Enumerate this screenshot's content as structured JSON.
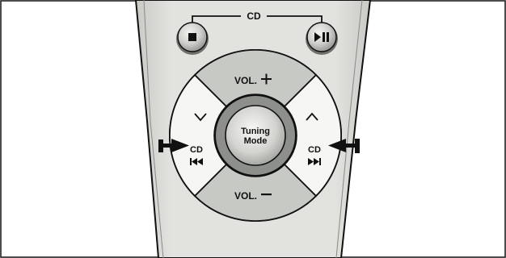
{
  "cd_group_label": "CD",
  "buttons": {
    "stop": {
      "icon": "stop-icon"
    },
    "play_pause": {
      "icon": "play-pause-icon"
    },
    "vol_up": {
      "label": "VOL."
    },
    "vol_down": {
      "label": "VOL."
    },
    "tuning_down": {
      "icon": "chevron-down-icon"
    },
    "tuning_up": {
      "icon": "chevron-up-icon"
    },
    "cd_prev": {
      "label": "CD",
      "icon": "skip-back-icon"
    },
    "cd_next": {
      "label": "CD",
      "icon": "skip-forward-icon"
    },
    "tuning_mode": {
      "line1": "Tuning",
      "line2": "Mode"
    }
  },
  "colors": {
    "remote_body": "#d9dad6",
    "button_fill": "#c4c6c2",
    "outline": "#111111",
    "background": "#ffffff"
  }
}
